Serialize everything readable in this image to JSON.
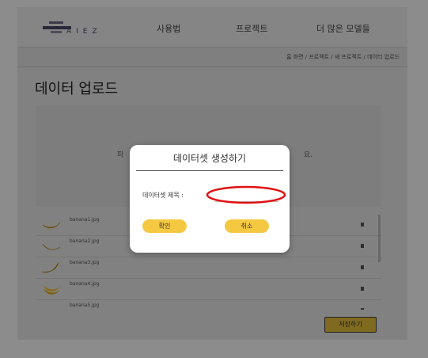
{
  "nav": {
    "logo_text": "AIEZ",
    "links": [
      "사용법",
      "프로젝트",
      "더 많은 모델들"
    ]
  },
  "breadcrumb": "홈 화면 / 프로젝트 / 새 프로젝트 / 데이터 업로드",
  "page_title": "데이터 업로드",
  "dropzone": {
    "text_left": "파",
    "text_right": "요."
  },
  "files": [
    {
      "name": "banana1.jpg"
    },
    {
      "name": "banana2.jpg"
    },
    {
      "name": "banana3.jpg"
    },
    {
      "name": "banana4.jpg"
    },
    {
      "name": "banana5.jpg"
    }
  ],
  "save_label": "저장하기",
  "modal": {
    "title": "데이터셋 생성하기",
    "field_label": "데이터셋 제목 :",
    "field_value": "",
    "confirm_label": "확인",
    "cancel_label": "취소"
  },
  "colors": {
    "accent": "#f5c842",
    "highlight": "#e01010"
  },
  "icons": [
    "banana-thumbnail-icon",
    "trash-icon"
  ]
}
